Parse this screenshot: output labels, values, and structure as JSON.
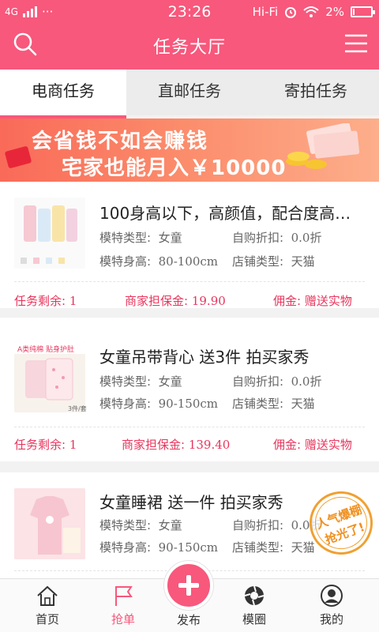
{
  "status_bar": {
    "network": "4G",
    "dots": "···",
    "time": "23:26",
    "wifi_label": "Hi-Fi",
    "battery": "2%"
  },
  "header": {
    "title": "任务大厅",
    "search_icon": "search-icon",
    "menu_icon": "menu-icon"
  },
  "tabs": [
    {
      "label": "电商任务",
      "active": true
    },
    {
      "label": "直邮任务",
      "active": false
    },
    {
      "label": "寄拍任务",
      "active": false
    }
  ],
  "banner": {
    "line1": "会省钱不如会赚钱",
    "line2": "宅家也能月入￥10000"
  },
  "labels": {
    "model_type": "模特类型:",
    "model_height": "模特身高:",
    "auto_discount": "自购折扣:",
    "shop_type": "店铺类型:",
    "remaining": "任务剩余:",
    "deposit": "商家担保金:",
    "commission": "佣金:"
  },
  "tasks": [
    {
      "title": "100身高以下，高颜值，配合度高…",
      "model_type": "女童",
      "auto_discount": "0.0折",
      "model_height": "80-100cm",
      "shop_type": "天猫",
      "remaining": "1",
      "deposit": "19.90",
      "commission": "赠送实物"
    },
    {
      "title": "女童吊带背心 送3件 拍买家秀",
      "model_type": "女童",
      "auto_discount": "0.0折",
      "model_height": "90-150cm",
      "shop_type": "天猫",
      "remaining": "1",
      "deposit": "139.40",
      "commission": "赠送实物",
      "thumb_caption_top": "A类纯棉 贴身护肚",
      "thumb_caption_bottom": "3件/套"
    },
    {
      "title": "女童睡裙 送一件 拍买家秀",
      "model_type": "女童",
      "auto_discount": "0.0折",
      "model_height": "90-150cm",
      "shop_type": "天猫"
    }
  ],
  "stamp": {
    "line1": "人气爆棚",
    "line2": "抢光了!"
  },
  "bottom_nav": [
    {
      "label": "首页",
      "icon": "home-icon",
      "active": false
    },
    {
      "label": "抢单",
      "icon": "flag-icon",
      "active": true
    },
    {
      "label": "发布",
      "icon": "plus-icon",
      "active": false
    },
    {
      "label": "模圈",
      "icon": "aperture-icon",
      "active": false
    },
    {
      "label": "我的",
      "icon": "user-icon",
      "active": false
    }
  ],
  "colors": {
    "brand": "#f7587c",
    "accent_text": "#e8355c",
    "stamp": "#f0a030"
  }
}
